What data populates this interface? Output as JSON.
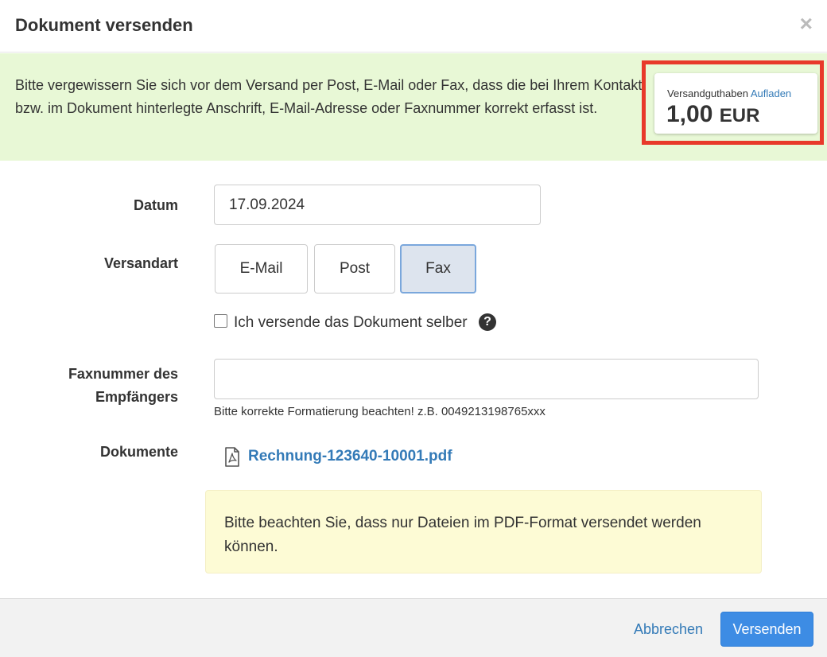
{
  "dialog": {
    "title": "Dokument versenden",
    "close_label": "×"
  },
  "notice": {
    "text": "Bitte vergewissern Sie sich vor dem Versand per Post, E-Mail oder Fax, dass die bei Ihrem Kontakt bzw. im Dokument hinterlegte Anschrift, E-Mail-Adresse oder Faxnummer korrekt erfasst ist."
  },
  "credit": {
    "label": "Versandguthaben",
    "link": "Aufladen",
    "amount": "1,00",
    "currency": "EUR"
  },
  "form": {
    "date_label": "Datum",
    "date_value": "17.09.2024",
    "shipping_label": "Versandart",
    "shipping_options": [
      {
        "label": "E-Mail",
        "active": false
      },
      {
        "label": "Post",
        "active": false
      },
      {
        "label": "Fax",
        "active": true
      }
    ],
    "self_send_label": "Ich versende das Dokument selber",
    "self_send_checked": false,
    "help_icon": "question-circle-icon",
    "fax_label_line1": "Faxnummer des",
    "fax_label_line2": "Empfängers",
    "fax_value": "",
    "fax_hint": "Bitte korrekte Formatierung beachten! z.B. 0049213198765xxx",
    "documents_label": "Dokumente",
    "document_file": "Rechnung-123640-10001.pdf",
    "document_icon": "pdf-file-icon",
    "pdf_notice": "Bitte beachten Sie, dass nur Dateien im PDF-Format versendet werden können."
  },
  "footer": {
    "cancel_label": "Abbrechen",
    "send_label": "Versenden"
  },
  "colors": {
    "notice_bg": "#e8f8d6",
    "highlight_border": "#e8392a",
    "link": "#337ab7",
    "primary_button": "#3d8ce4",
    "warning_bg": "#fdfbd5",
    "active_option_bg": "#dde4ee"
  }
}
